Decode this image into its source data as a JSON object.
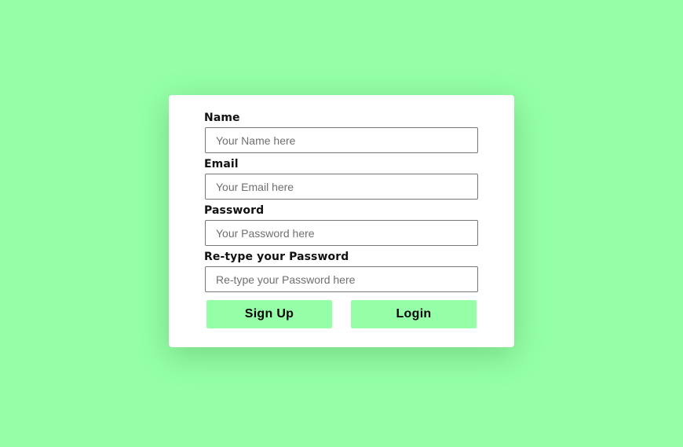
{
  "form": {
    "name": {
      "label": "Name",
      "placeholder": "Your Name here"
    },
    "email": {
      "label": "Email",
      "placeholder": "Your Email here"
    },
    "password": {
      "label": "Password",
      "placeholder": "Your Password here"
    },
    "retype_password": {
      "label": "Re-type your Password",
      "placeholder": "Re-type your Password here"
    }
  },
  "buttons": {
    "signup_label": "Sign Up",
    "login_label": "Login"
  },
  "colors": {
    "background": "#94ffa6",
    "button": "#94ffa6",
    "card": "#ffffff"
  }
}
